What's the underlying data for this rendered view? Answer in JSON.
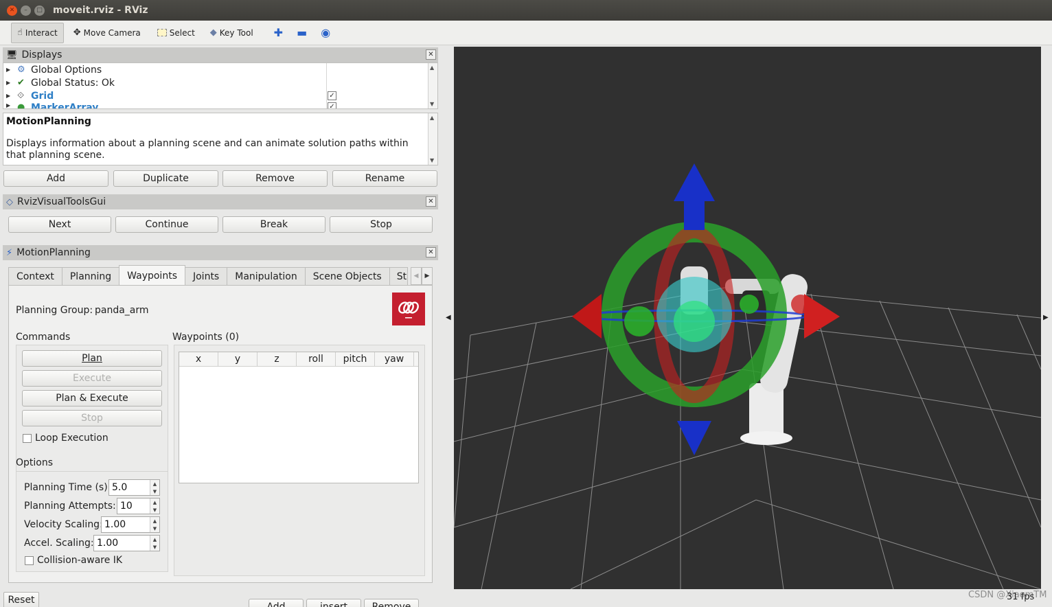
{
  "window": {
    "title": "moveit.rviz - RViz"
  },
  "toolbar": {
    "interact": "Interact",
    "move_camera": "Move Camera",
    "select": "Select",
    "key_tool": "Key Tool"
  },
  "displays": {
    "title": "Displays",
    "items": [
      {
        "label": "Global Options",
        "icon": "gear-icon",
        "checked": null
      },
      {
        "label": "Global Status: Ok",
        "icon": "checkmark-icon",
        "checked": null
      },
      {
        "label": "Grid",
        "icon": "grid-icon",
        "checked": true
      },
      {
        "label": "MarkerArray",
        "icon": "marker-icon",
        "checked": true
      }
    ],
    "desc_title": "MotionPlanning",
    "desc_text": "Displays information about a planning scene and can animate solution paths within that planning scene.",
    "buttons": {
      "add": "Add",
      "duplicate": "Duplicate",
      "remove": "Remove",
      "rename": "Rename"
    }
  },
  "rvt": {
    "title": "RvizVisualToolsGui",
    "buttons": {
      "next": "Next",
      "continue": "Continue",
      "break": "Break",
      "stop": "Stop"
    }
  },
  "motion": {
    "title": "MotionPlanning",
    "tabs": [
      "Context",
      "Planning",
      "Waypoints",
      "Joints",
      "Manipulation",
      "Scene Objects",
      "St"
    ],
    "selected_tab": "Waypoints",
    "planning_group_label": "Planning Group:",
    "planning_group": "panda_arm",
    "commands_label": "Commands",
    "plan": "Plan",
    "execute": "Execute",
    "plan_execute": "Plan & Execute",
    "stop": "Stop",
    "loop_execution": "Loop Execution",
    "options_label": "Options",
    "planning_time_label": "Planning Time (s):",
    "planning_time": "5.0",
    "planning_attempts_label": "Planning Attempts:",
    "planning_attempts": "10",
    "velocity_label": "Velocity Scaling:",
    "velocity": "1.00",
    "accel_label": "Accel. Scaling:",
    "accel": "1.00",
    "collision_ik": "Collision-aware IK",
    "waypoints_label": "Waypoints (0)",
    "columns": [
      "x",
      "y",
      "z",
      "roll",
      "pitch",
      "yaw"
    ],
    "wp_add": "Add",
    "wp_insert": "insert",
    "wp_remove": "Remove"
  },
  "bottom": {
    "reset": "Reset",
    "fps": "31 fps",
    "watermark": "CSDN @XiaomTM"
  }
}
